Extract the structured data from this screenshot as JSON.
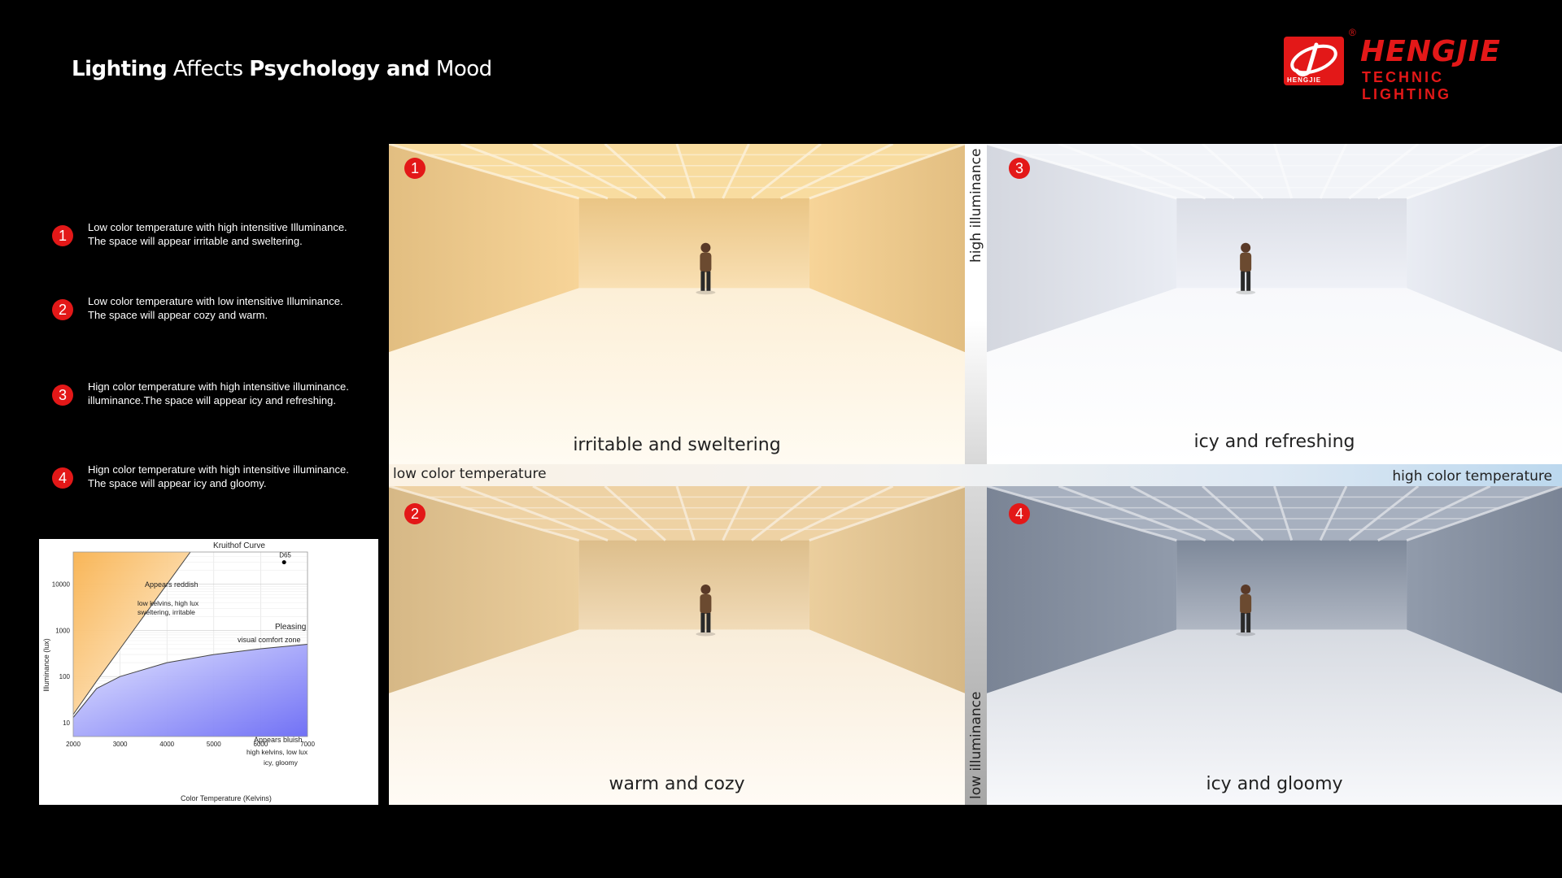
{
  "header": {
    "title_parts": [
      "Lighting",
      " Affects ",
      "Psychology and",
      " Mood"
    ]
  },
  "logo": {
    "name": "HENGJIE",
    "subtitle": "TECHNIC LIGHTING",
    "badge_text": "HENGJIE",
    "reg": "®",
    "brand_color": "#e31818"
  },
  "legend": [
    {
      "num": "1",
      "line1": "Low color temperature with high intensitive Illuminance.",
      "line2": "The space will appear irritable and sweltering."
    },
    {
      "num": "2",
      "line1": "Low color temperature with low intensitive Illuminance.",
      "line2": "The space will appear cozy and warm."
    },
    {
      "num": "3",
      "line1": "Hign color temperature with high intensitive illuminance.",
      "line2": "illuminance.The space will appear icy and refreshing."
    },
    {
      "num": "4",
      "line1": "Hign color temperature with high intensitive illuminance.",
      "line2": "The space will appear icy and gloomy."
    }
  ],
  "panels": [
    {
      "num": "1",
      "caption": "irritable and sweltering",
      "wall": "#f6cf8c",
      "floor": "#fffbf2",
      "ceiling": "#f8dca0"
    },
    {
      "num": "3",
      "caption": "icy and refreshing",
      "wall": "#e6eaf2",
      "floor": "#ffffff",
      "ceiling": "#f2f4f8"
    },
    {
      "num": "2",
      "caption": "warm and cozy",
      "wall": "#e9c892",
      "floor": "#fffbf5",
      "ceiling": "#eed2a4"
    },
    {
      "num": "4",
      "caption": "icy and gloomy",
      "wall": "#8590a2",
      "floor": "#f7f8fb",
      "ceiling": "#a7b0bf"
    }
  ],
  "axes": {
    "high_illuminance": "high illuminance",
    "low_illuminance": "low illuminance",
    "low_color_temperature": "low color temperature",
    "high_color_temperature": "high color temperature"
  },
  "kruithof": {
    "title": "Kruithof Curve",
    "d65": "D65",
    "xlabel": "Color Temperature (Kelvins)",
    "ylabel": "Illuminance (lux)",
    "xticks": [
      "2000",
      "3000",
      "4000",
      "5000",
      "6000",
      "7000"
    ],
    "yticks": [
      "10",
      "100",
      "1000",
      "10000"
    ],
    "zone_reddish_title": "Appears reddish",
    "zone_reddish_l1": "low kelvins, high lux",
    "zone_reddish_l2": "sweltering, irritable",
    "zone_pleasing_title": "Pleasing",
    "zone_pleasing_l1": "visual comfort zone",
    "zone_bluish_title": "Appears bluish",
    "zone_bluish_l1": "high kelvins, low lux",
    "zone_bluish_l2": "icy, gloomy"
  },
  "chart_data": {
    "type": "line",
    "title": "Kruithof Curve",
    "xlabel": "Color Temperature (Kelvins)",
    "ylabel": "Illuminance (lux)",
    "xlim": [
      2000,
      7000
    ],
    "ylim": [
      5,
      50000
    ],
    "yscale": "log",
    "series": [
      {
        "x": [
          2000,
          2500,
          3000,
          3500,
          4000,
          4500
        ],
        "y": [
          15,
          80,
          400,
          2000,
          10000,
          50000
        ]
      },
      {
        "x": [
          2000,
          2500,
          3000,
          4000,
          5000,
          6000,
          7000
        ],
        "y": [
          13,
          55,
          100,
          200,
          300,
          400,
          500
        ]
      }
    ],
    "points": [
      {
        "name": "D65",
        "x": 6500,
        "y": 30000
      }
    ],
    "grid": true
  }
}
